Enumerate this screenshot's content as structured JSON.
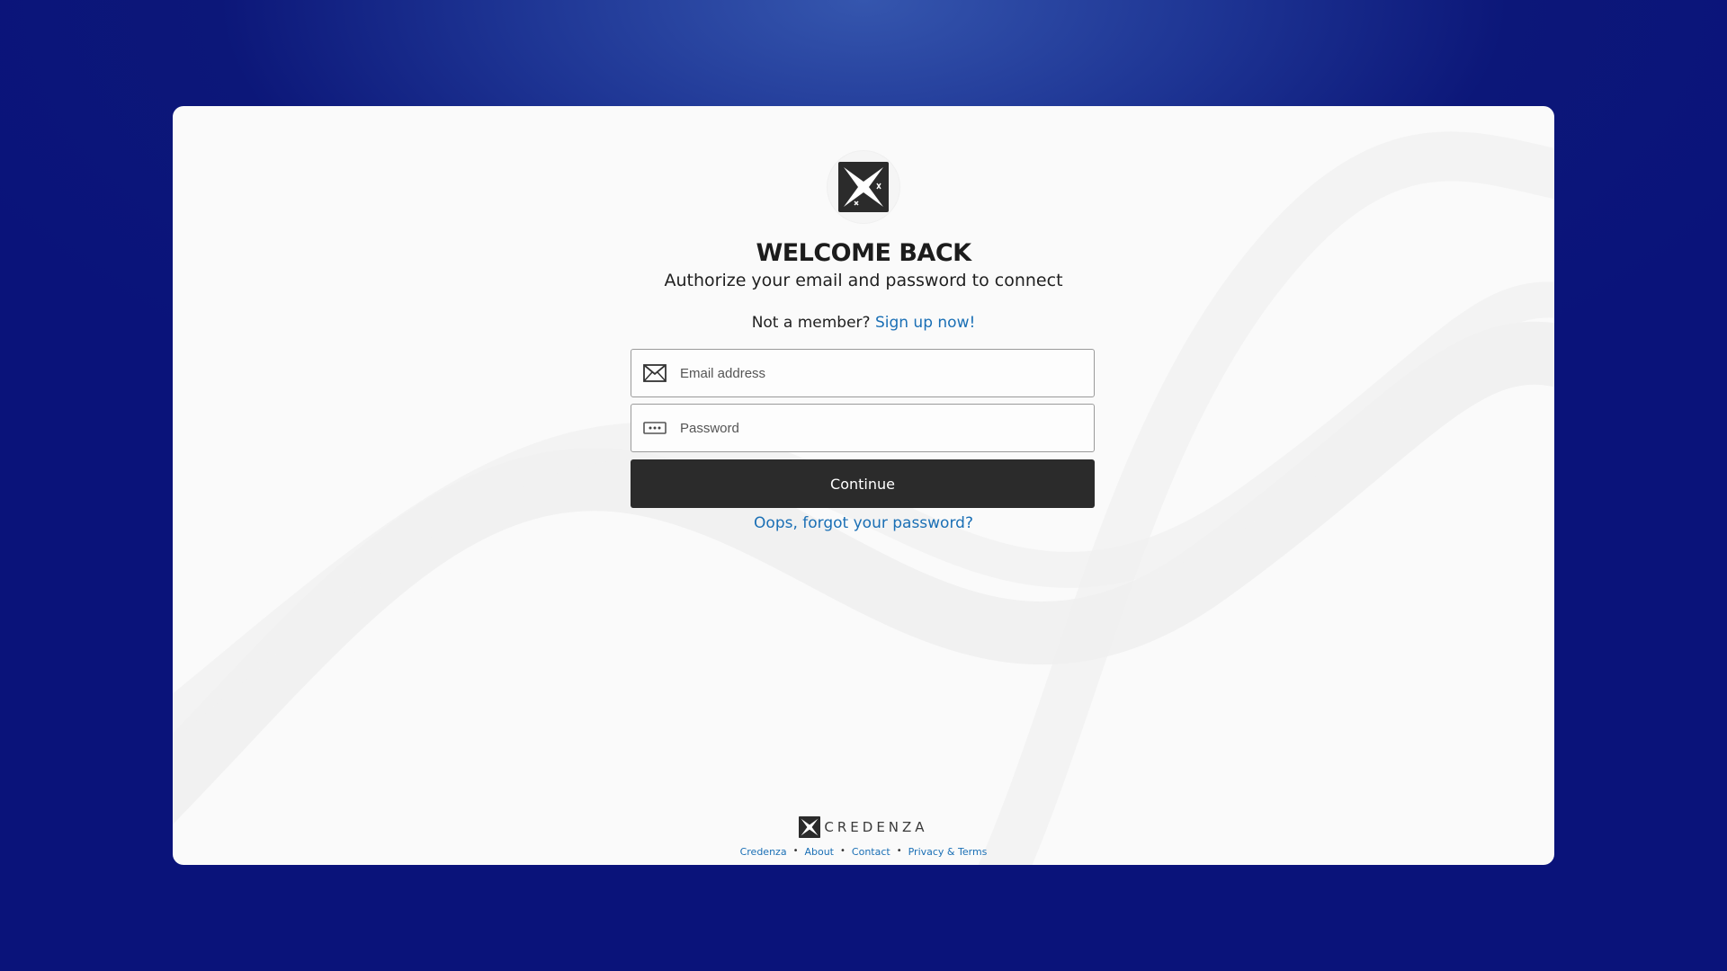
{
  "login": {
    "title": "WELCOME BACK",
    "subtitle": "Authorize your email and password to connect",
    "signup_prompt": "Not a member?",
    "signup_link": "Sign up now!",
    "email_placeholder": "Email address",
    "password_placeholder": "Password",
    "continue_label": "Continue",
    "forgot_link": "Oops, forgot your password?"
  },
  "icons": {
    "logo": "credenza-logo-icon",
    "email": "envelope-icon",
    "password": "password-dots-icon"
  },
  "footer": {
    "brand_name": "CREDENZA",
    "links": [
      "Credenza",
      "About",
      "Contact",
      "Privacy & Terms"
    ],
    "separator": "•"
  },
  "colors": {
    "background": "#0c1779",
    "link": "#1a6fb5",
    "button": "#2b2b2b"
  }
}
